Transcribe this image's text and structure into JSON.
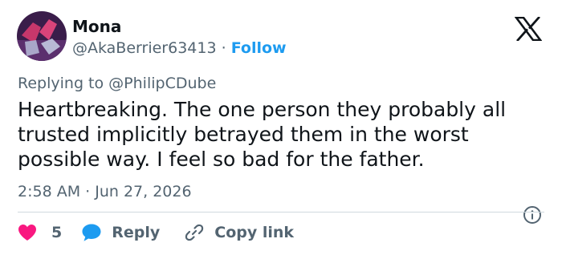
{
  "user": {
    "display_name": "Mona",
    "handle": "@AkaBerrier63413",
    "separator": "·",
    "follow_label": "Follow",
    "avatar": "avatar-photo"
  },
  "brand": {
    "icon": "x-logo-icon"
  },
  "reply_context": {
    "prefix": "Replying to",
    "mention": "@PhilipCDube"
  },
  "tweet": {
    "text": "Heartbreaking. The one person they probably all trusted implicitly betrayed them in the worst possible way. I feel so bad for the father.",
    "timestamp": "2:58 AM · Jun 27, 2026"
  },
  "actions": {
    "like_count": "5",
    "reply_label": "Reply",
    "copy_label": "Copy link"
  },
  "colors": {
    "link_blue": "#1d9bf0",
    "heart_pink": "#f91880",
    "muted_gray": "#536471",
    "text_dark": "#0f1419"
  }
}
